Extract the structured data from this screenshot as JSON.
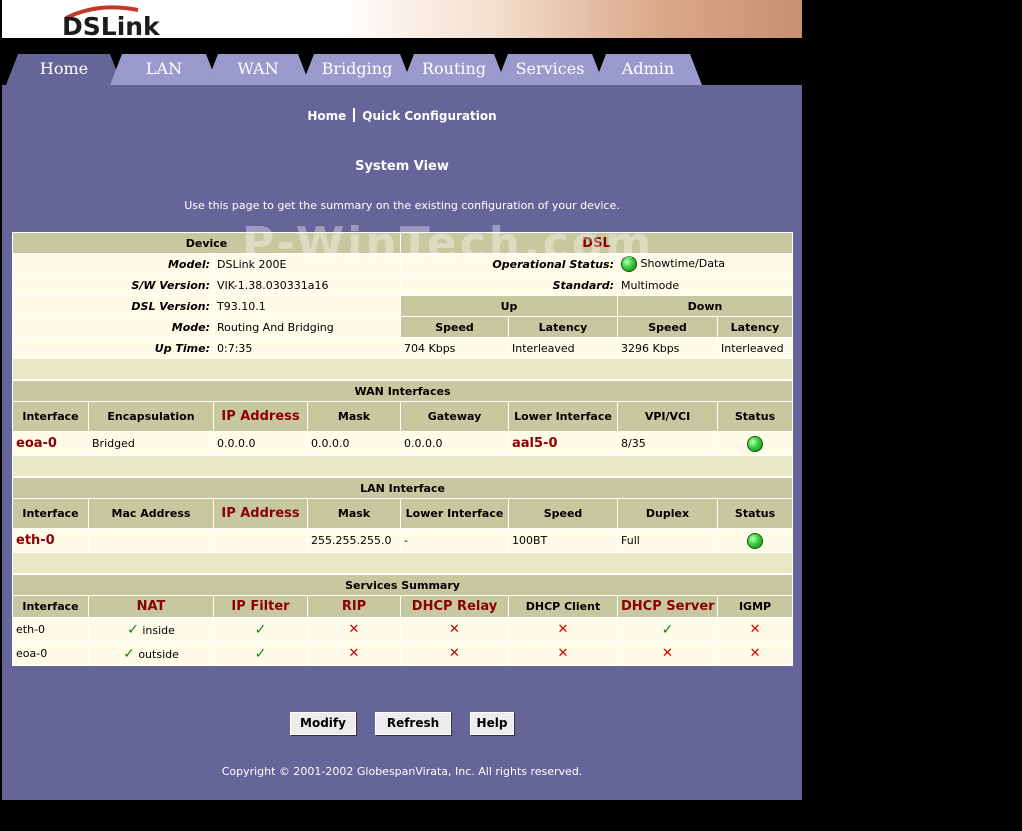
{
  "brand": {
    "logo_text": "DSLink"
  },
  "tabs": [
    {
      "label": "Home",
      "active": true
    },
    {
      "label": "LAN"
    },
    {
      "label": "WAN"
    },
    {
      "label": "Bridging"
    },
    {
      "label": "Routing"
    },
    {
      "label": "Services"
    },
    {
      "label": "Admin"
    }
  ],
  "breadcrumb": {
    "home": "Home",
    "current": "Quick Configuration"
  },
  "page": {
    "title": "System View",
    "description": "Use this page to get the summary on the existing configuration of your device."
  },
  "watermark": "P-WinTech.com",
  "device": {
    "header": "Device",
    "rows": [
      {
        "label": "Model:",
        "value": "DSLink 200E"
      },
      {
        "label": "S/W Version:",
        "value": "VIK-1.38.030331a16"
      },
      {
        "label": "DSL Version:",
        "value": "T93.10.1"
      },
      {
        "label": "Mode:",
        "value": "Routing And Bridging"
      },
      {
        "label": "Up Time:",
        "value": "0:7:35"
      }
    ]
  },
  "dsl": {
    "header": "DSL",
    "operational_status_label": "Operational Status:",
    "operational_status_value": "Showtime/Data",
    "standard_label": "Standard:",
    "standard_value": "Multimode",
    "up_label": "Up",
    "down_label": "Down",
    "speed_label": "Speed",
    "latency_label": "Latency",
    "up_speed": "704 Kbps",
    "up_latency": "Interleaved",
    "down_speed": "3296 Kbps",
    "down_latency": "Interleaved"
  },
  "wan": {
    "header": "WAN Interfaces",
    "columns": [
      "Interface",
      "Encapsulation",
      "IP Address",
      "Mask",
      "Gateway",
      "Lower Interface",
      "VPI/VCI",
      "Status"
    ],
    "row": {
      "interface": "eoa-0",
      "encapsulation": "Bridged",
      "ip": "0.0.0.0",
      "mask": "0.0.0.0",
      "gateway": "0.0.0.0",
      "lower": "aal5-0",
      "vpivci": "8/35",
      "status_icon": "green-status-icon"
    }
  },
  "lan": {
    "header": "LAN Interface",
    "columns": [
      "Interface",
      "Mac Address",
      "IP Address",
      "Mask",
      "Lower Interface",
      "Speed",
      "Duplex",
      "Status"
    ],
    "row": {
      "interface": "eth-0",
      "mac": "",
      "ip": "",
      "mask": "255.255.255.0",
      "lower": "-",
      "speed": "100BT",
      "duplex": "Full",
      "status_icon": "green-status-icon"
    }
  },
  "services": {
    "header": "Services Summary",
    "columns": [
      "Interface",
      "NAT",
      "IP Filter",
      "RIP",
      "DHCP Relay",
      "DHCP Client",
      "DHCP Server",
      "IGMP"
    ],
    "rows": [
      {
        "interface": "eth-0",
        "nat_note": "inside"
      },
      {
        "interface": "eoa-0",
        "nat_note": "outside"
      }
    ],
    "check_icon": "check-icon",
    "cross_icon": "cross-icon"
  },
  "buttons": {
    "modify": "Modify",
    "refresh": "Refresh",
    "help": "Help"
  },
  "copyright": "Copyright © 2001-2002 GlobespanVirata, Inc. All rights reserved.",
  "colors": {
    "panel": "#65659a",
    "tab": "#9a9acc",
    "table_header": "#c8c8a0",
    "table_body": "#fffbe8",
    "accent_red": "#8b0000"
  }
}
